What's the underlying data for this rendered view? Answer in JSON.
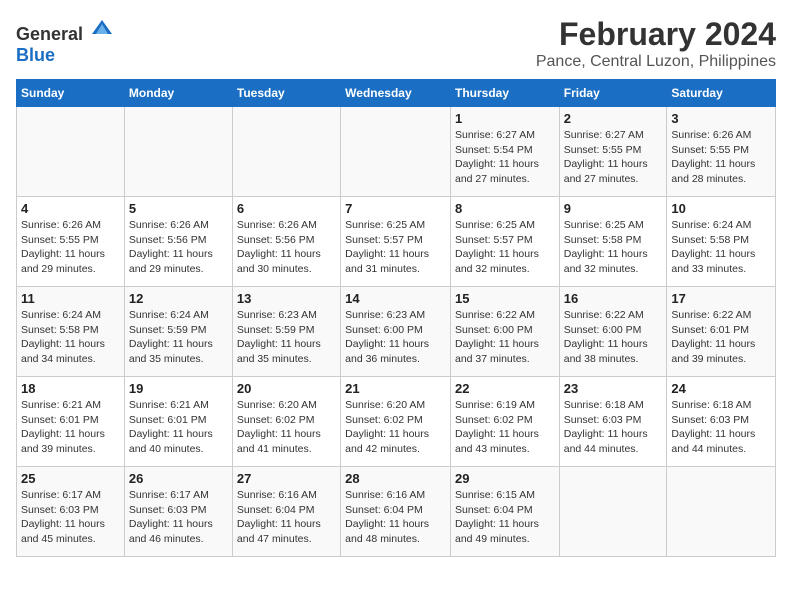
{
  "logo": {
    "text_general": "General",
    "text_blue": "Blue"
  },
  "title": "February 2024",
  "subtitle": "Pance, Central Luzon, Philippines",
  "days_of_week": [
    "Sunday",
    "Monday",
    "Tuesday",
    "Wednesday",
    "Thursday",
    "Friday",
    "Saturday"
  ],
  "weeks": [
    [
      {
        "day": "",
        "info": ""
      },
      {
        "day": "",
        "info": ""
      },
      {
        "day": "",
        "info": ""
      },
      {
        "day": "",
        "info": ""
      },
      {
        "day": "1",
        "info": "Sunrise: 6:27 AM\nSunset: 5:54 PM\nDaylight: 11 hours and 27 minutes."
      },
      {
        "day": "2",
        "info": "Sunrise: 6:27 AM\nSunset: 5:55 PM\nDaylight: 11 hours and 27 minutes."
      },
      {
        "day": "3",
        "info": "Sunrise: 6:26 AM\nSunset: 5:55 PM\nDaylight: 11 hours and 28 minutes."
      }
    ],
    [
      {
        "day": "4",
        "info": "Sunrise: 6:26 AM\nSunset: 5:55 PM\nDaylight: 11 hours and 29 minutes."
      },
      {
        "day": "5",
        "info": "Sunrise: 6:26 AM\nSunset: 5:56 PM\nDaylight: 11 hours and 29 minutes."
      },
      {
        "day": "6",
        "info": "Sunrise: 6:26 AM\nSunset: 5:56 PM\nDaylight: 11 hours and 30 minutes."
      },
      {
        "day": "7",
        "info": "Sunrise: 6:25 AM\nSunset: 5:57 PM\nDaylight: 11 hours and 31 minutes."
      },
      {
        "day": "8",
        "info": "Sunrise: 6:25 AM\nSunset: 5:57 PM\nDaylight: 11 hours and 32 minutes."
      },
      {
        "day": "9",
        "info": "Sunrise: 6:25 AM\nSunset: 5:58 PM\nDaylight: 11 hours and 32 minutes."
      },
      {
        "day": "10",
        "info": "Sunrise: 6:24 AM\nSunset: 5:58 PM\nDaylight: 11 hours and 33 minutes."
      }
    ],
    [
      {
        "day": "11",
        "info": "Sunrise: 6:24 AM\nSunset: 5:58 PM\nDaylight: 11 hours and 34 minutes."
      },
      {
        "day": "12",
        "info": "Sunrise: 6:24 AM\nSunset: 5:59 PM\nDaylight: 11 hours and 35 minutes."
      },
      {
        "day": "13",
        "info": "Sunrise: 6:23 AM\nSunset: 5:59 PM\nDaylight: 11 hours and 35 minutes."
      },
      {
        "day": "14",
        "info": "Sunrise: 6:23 AM\nSunset: 6:00 PM\nDaylight: 11 hours and 36 minutes."
      },
      {
        "day": "15",
        "info": "Sunrise: 6:22 AM\nSunset: 6:00 PM\nDaylight: 11 hours and 37 minutes."
      },
      {
        "day": "16",
        "info": "Sunrise: 6:22 AM\nSunset: 6:00 PM\nDaylight: 11 hours and 38 minutes."
      },
      {
        "day": "17",
        "info": "Sunrise: 6:22 AM\nSunset: 6:01 PM\nDaylight: 11 hours and 39 minutes."
      }
    ],
    [
      {
        "day": "18",
        "info": "Sunrise: 6:21 AM\nSunset: 6:01 PM\nDaylight: 11 hours and 39 minutes."
      },
      {
        "day": "19",
        "info": "Sunrise: 6:21 AM\nSunset: 6:01 PM\nDaylight: 11 hours and 40 minutes."
      },
      {
        "day": "20",
        "info": "Sunrise: 6:20 AM\nSunset: 6:02 PM\nDaylight: 11 hours and 41 minutes."
      },
      {
        "day": "21",
        "info": "Sunrise: 6:20 AM\nSunset: 6:02 PM\nDaylight: 11 hours and 42 minutes."
      },
      {
        "day": "22",
        "info": "Sunrise: 6:19 AM\nSunset: 6:02 PM\nDaylight: 11 hours and 43 minutes."
      },
      {
        "day": "23",
        "info": "Sunrise: 6:18 AM\nSunset: 6:03 PM\nDaylight: 11 hours and 44 minutes."
      },
      {
        "day": "24",
        "info": "Sunrise: 6:18 AM\nSunset: 6:03 PM\nDaylight: 11 hours and 44 minutes."
      }
    ],
    [
      {
        "day": "25",
        "info": "Sunrise: 6:17 AM\nSunset: 6:03 PM\nDaylight: 11 hours and 45 minutes."
      },
      {
        "day": "26",
        "info": "Sunrise: 6:17 AM\nSunset: 6:03 PM\nDaylight: 11 hours and 46 minutes."
      },
      {
        "day": "27",
        "info": "Sunrise: 6:16 AM\nSunset: 6:04 PM\nDaylight: 11 hours and 47 minutes."
      },
      {
        "day": "28",
        "info": "Sunrise: 6:16 AM\nSunset: 6:04 PM\nDaylight: 11 hours and 48 minutes."
      },
      {
        "day": "29",
        "info": "Sunrise: 6:15 AM\nSunset: 6:04 PM\nDaylight: 11 hours and 49 minutes."
      },
      {
        "day": "",
        "info": ""
      },
      {
        "day": "",
        "info": ""
      }
    ]
  ]
}
